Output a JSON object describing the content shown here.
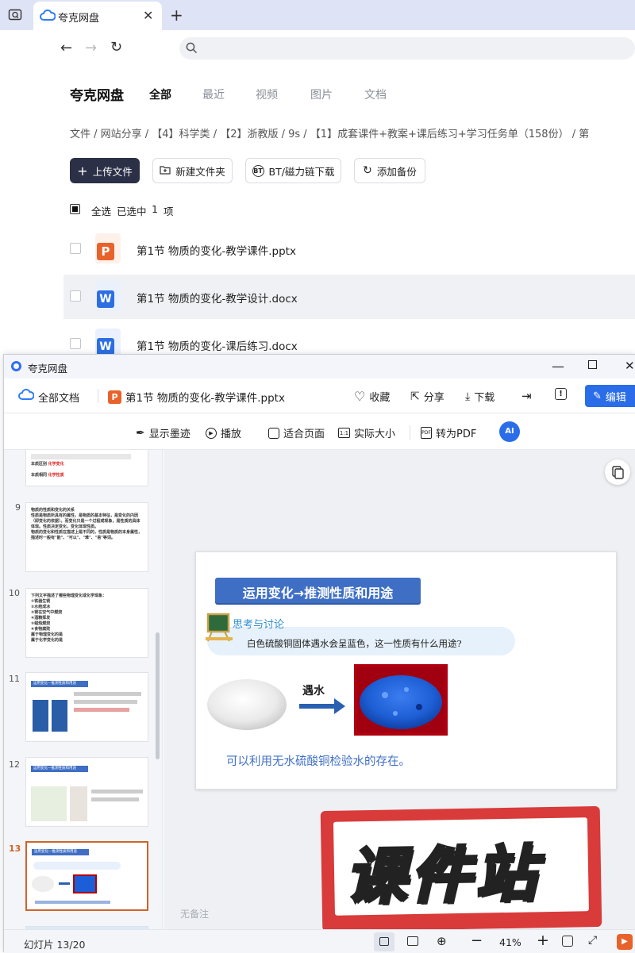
{
  "browser": {
    "tab_title": "夸克网盘",
    "address": ""
  },
  "app": {
    "logo": "夸克网盘",
    "nav_tabs": [
      "全部",
      "最近",
      "视频",
      "图片",
      "文档"
    ],
    "breadcrumb": "文件 / 网站分享 / 【4】科学类 / 【2】浙教版 / 9s / 【1】成套课件+教案+课后练习+学习任务单（158份） / 第",
    "buttons": {
      "upload": "上传文件",
      "new_folder": "新建文件夹",
      "bt": "BT/磁力链下载",
      "backup": "添加备份"
    },
    "select_all": "全选",
    "selected_label": "已选中",
    "selected_count": "1",
    "selected_unit": "项",
    "files": [
      {
        "name": "第1节 物质的变化-教学课件.pptx",
        "type": "ppt"
      },
      {
        "name": "第1节 物质的变化-教学设计.docx",
        "type": "doc"
      },
      {
        "name": "第1节 物质的变化-课后练习.docx",
        "type": "doc"
      }
    ]
  },
  "viewer": {
    "window_title": "夸克网盘",
    "all_docs": "全部文档",
    "doc_name": "第1节 物质的变化-教学课件.pptx",
    "actions": {
      "favorite": "收藏",
      "share": "分享",
      "download": "下载",
      "edit": "编辑"
    },
    "tools": {
      "ink": "显示墨迹",
      "play": "播放",
      "fit": "适合页面",
      "actual": "实际大小",
      "pdf": "转为PDF"
    },
    "thumbs": [
      {
        "num": "9",
        "text": "物质的性质和变化的关系\n性质是物质所具有的属性，是物质的基本特征，是变化的内因（即变化的依据）。而变化只是一个过程或现象，是性质的具体体现。性质决定变化，变化体现性质。\n物质的变化和性质在描述上是不同的，性质是物质的本身属性，描述时一般有\"能\"、\"可以\"、\"难\"、\"易\"等词。"
      },
      {
        "num": "10",
        "text": "下列文字描述了哪些物理变化或化学现象：\n①铁器生锈\n②水结成冰\n③镁在空气中燃烧\n④酒精挥发\n⑤蜡烛燃烧\n⑥食物腐败\n属于物理变化的是\n属于化学变化的是"
      },
      {
        "num": "11",
        "text": "运用变化—推测性质和用途"
      },
      {
        "num": "12",
        "text": "运用变化—推测性质和用途"
      },
      {
        "num": "13",
        "text": "运用变化—推测性质和用途"
      }
    ],
    "thumb8_lines": [
      "本质区别",
      "本质相同",
      "化学变化",
      "化学性质"
    ],
    "slide": {
      "title": "运用变化→推测性质和用途",
      "think": "思考与讨论",
      "question": "白色硫酸铜固体遇水会呈蓝色，这一性质有什么用途?",
      "arrow_label": "遇水",
      "conclusion": "可以利用无水硫酸铜检验水的存在。"
    },
    "watermark": "课件站",
    "notes": "无备注",
    "status": {
      "slide_label": "幻灯片 13/20",
      "zoom": "41%"
    }
  },
  "colors": {
    "accent": "#2b6de8",
    "selected": "#d0632a",
    "slide_blue": "#3f6fc4",
    "watermark_red": "#d93a3a"
  }
}
